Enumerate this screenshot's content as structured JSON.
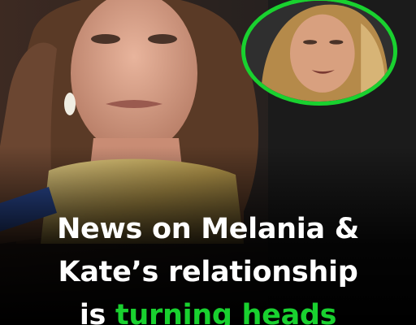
{
  "headline": {
    "line1": "News on Melania &",
    "line2": "Kate’s relationship",
    "line3_prefix": "is ",
    "line3_highlight": "turning heads"
  },
  "colors": {
    "headline_text": "#ffffff",
    "highlight": "#19d12f",
    "inset_border": "#19d12f",
    "background": "#000000"
  },
  "images": {
    "main_photo": "woman-in-gold-gown-photo",
    "inset_photo": "blonde-woman-portrait-circle"
  }
}
